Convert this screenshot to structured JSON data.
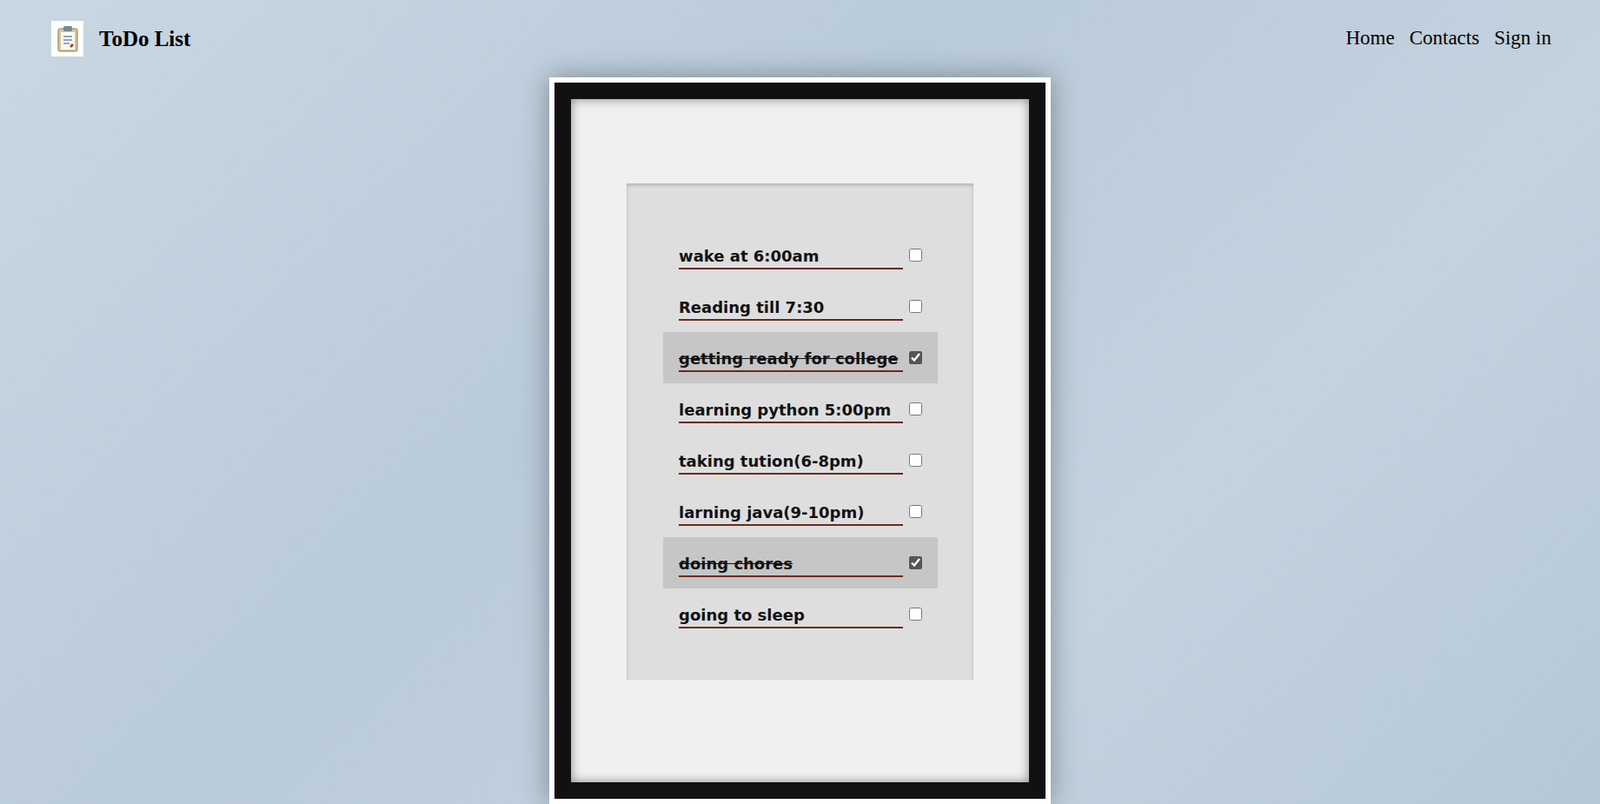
{
  "header": {
    "title": "ToDo List",
    "nav": [
      "Home",
      "Contacts",
      "Sign in"
    ]
  },
  "todos": [
    {
      "text": "wake at 6:00am",
      "checked": false
    },
    {
      "text": "Reading till 7:30",
      "checked": false
    },
    {
      "text": "getting ready for college",
      "checked": true
    },
    {
      "text": "learning python 5:00pm",
      "checked": false
    },
    {
      "text": "taking tution(6-8pm)",
      "checked": false
    },
    {
      "text": "larning java(9-10pm)",
      "checked": false
    },
    {
      "text": "doing chores",
      "checked": true
    },
    {
      "text": "going to sleep",
      "checked": false
    }
  ]
}
